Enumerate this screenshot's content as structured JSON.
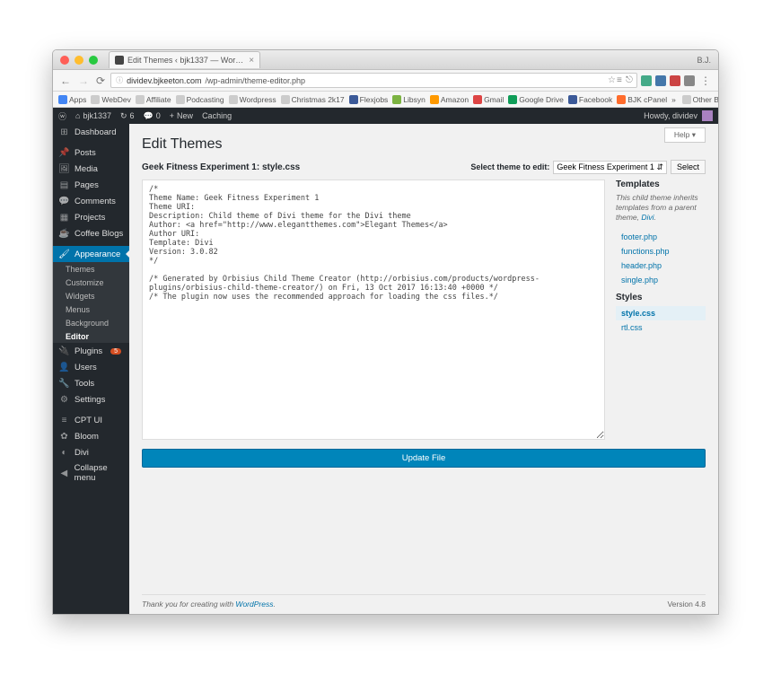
{
  "browser": {
    "tab_title": "Edit Themes ‹ bjk1337 — Wor…",
    "user_initials": "B.J.",
    "url_host": "dividev.bjkeeton.com",
    "url_path": "/wp-admin/theme-editor.php"
  },
  "bookmarks": [
    "Apps",
    "WebDev",
    "Affiliate",
    "Podcasting",
    "Wordpress",
    "Christmas 2k17",
    "Flexjobs",
    "Libsyn",
    "Amazon",
    "Gmail",
    "Google Drive",
    "Facebook",
    "BJK cPanel"
  ],
  "bookmarks_overflow": "Other Bookmarks",
  "topbar": {
    "site": "bjk1337",
    "updates": "6",
    "comments": "0",
    "new": "New",
    "caching": "Caching",
    "howdy": "Howdy, dividev"
  },
  "sidebar": {
    "dashboard": "Dashboard",
    "posts": "Posts",
    "media": "Media",
    "pages": "Pages",
    "comments": "Comments",
    "projects": "Projects",
    "coffee": "Coffee Blogs",
    "appearance": "Appearance",
    "sub_themes": "Themes",
    "sub_customize": "Customize",
    "sub_widgets": "Widgets",
    "sub_menus": "Menus",
    "sub_background": "Background",
    "sub_editor": "Editor",
    "plugins": "Plugins",
    "plugins_badge": "5",
    "users": "Users",
    "tools": "Tools",
    "settings": "Settings",
    "cptui": "CPT UI",
    "bloom": "Bloom",
    "divi": "Divi",
    "collapse": "Collapse menu"
  },
  "page": {
    "help": "Help ▾",
    "title": "Edit Themes",
    "subhead": "Geek Fitness Experiment 1: style.css",
    "select_label": "Select theme to edit:",
    "select_value": "Geek Fitness Experiment 1",
    "select_button": "Select",
    "update_button": "Update File",
    "footer_pre": "Thank you for creating with ",
    "footer_link": "WordPress",
    "version": "Version 4.8"
  },
  "editor_code": "/*\nTheme Name: Geek Fitness Experiment 1\nTheme URI:\nDescription: Child theme of Divi theme for the Divi theme\nAuthor: <a href=\"http://www.elegantthemes.com\">Elegant Themes</a>\nAuthor URI:\nTemplate: Divi\nVersion: 3.0.82\n*/\n\n/* Generated by Orbisius Child Theme Creator (http://orbisius.com/products/wordpress-plugins/orbisius-child-theme-creator/) on Fri, 13 Oct 2017 16:13:40 +0000 */\n/* The plugin now uses the recommended approach for loading the css files.*/",
  "files": {
    "templates_h": "Templates",
    "note": "This child theme inherits templates from a parent theme, ",
    "parent": "Divi",
    "templates": [
      "footer.php",
      "functions.php",
      "header.php",
      "single.php"
    ],
    "styles_h": "Styles",
    "styles": [
      "style.css",
      "rtl.css"
    ],
    "active": "style.css"
  }
}
